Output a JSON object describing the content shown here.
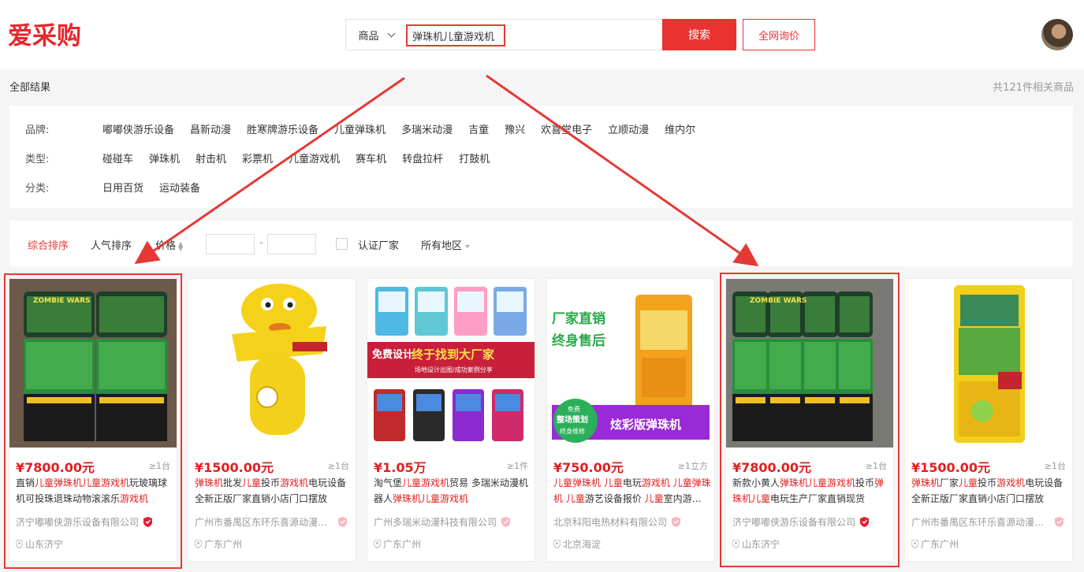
{
  "header": {
    "logo_text": "爱采购",
    "scope_label": "商品",
    "query": "弹珠机儿童游戏机",
    "search_label": "搜索",
    "inquiry_label": "全网询价"
  },
  "results": {
    "all_label": "全部结果",
    "count_text": "共121件相关商品"
  },
  "filters": {
    "brand": {
      "label": "品牌:",
      "items": [
        "嘟嘟侠游乐设备",
        "昌新动漫",
        "胜寒牌游乐设备",
        "儿童弹珠机",
        "多瑞米动漫",
        "吉童",
        "豫兴",
        "欢喜堂电子",
        "立顺动漫",
        "维内尔"
      ]
    },
    "type": {
      "label": "类型:",
      "items": [
        "碰碰车",
        "弹珠机",
        "射击机",
        "彩票机",
        "儿童游戏机",
        "赛车机",
        "转盘拉杆",
        "打鼓机"
      ]
    },
    "category": {
      "label": "分类:",
      "items": [
        "日用百货",
        "运动装备"
      ]
    }
  },
  "sort": {
    "overall": "综合排序",
    "popularity": "人气排序",
    "price": "价格",
    "price_sep": "-",
    "certified": "认证厂家",
    "region": "所有地区"
  },
  "products": [
    {
      "price": "¥7800.00元",
      "moq": "≥1台",
      "title_parts": [
        [
          "直销",
          false
        ],
        [
          "儿童弹珠机儿童游戏机",
          true
        ],
        [
          "玩玻璃球机可投珠退珠动物滚滚乐",
          false
        ],
        [
          "游戏机",
          true
        ]
      ],
      "company": "济宁嘟嘟侠游乐设备有限公司",
      "location": "山东济宁",
      "verified": "bold"
    },
    {
      "price": "¥1500.00元",
      "moq": "≥1台",
      "title_parts": [
        [
          "弹珠机",
          true
        ],
        [
          "批发",
          false
        ],
        [
          "儿童",
          true
        ],
        [
          "投币",
          false
        ],
        [
          "游戏机",
          true
        ],
        [
          "电玩设备全新正版厂家直销小店门口摆放",
          false
        ]
      ],
      "company": "广州市番禺区东环乐喜源动漫产…",
      "location": "广东广州",
      "verified": "light"
    },
    {
      "price": "¥1.05万",
      "moq": "≥1件",
      "title_parts": [
        [
          "淘气堡",
          false
        ],
        [
          "儿童游戏机",
          true
        ],
        [
          "贸易 多瑞米动漫机器人",
          false
        ],
        [
          "弹珠机儿童游戏机",
          true
        ]
      ],
      "company": "广州多瑞米动漫科技有限公司",
      "location": "广东广州",
      "verified": "light"
    },
    {
      "price": "¥750.00元",
      "moq": "≥1立方",
      "title_parts": [
        [
          "儿童弹珠机 儿童",
          true
        ],
        [
          "电玩",
          false
        ],
        [
          "游戏机 儿童弹珠机 儿童",
          true
        ],
        [
          "游艺设备报价 ",
          false
        ],
        [
          "儿童",
          true
        ],
        [
          "室内游…",
          false
        ]
      ],
      "company": "北京科阳电热材料有限公司",
      "location": "北京海淀",
      "verified": "light"
    },
    {
      "price": "¥7800.00元",
      "moq": "≥1台",
      "title_parts": [
        [
          "新款小黄人",
          false
        ],
        [
          "弹珠机儿童游戏机",
          true
        ],
        [
          "投币",
          false
        ],
        [
          "弹珠机儿童",
          true
        ],
        [
          "电玩生产厂家直销现货",
          false
        ]
      ],
      "company": "济宁嘟嘟侠游乐设备有限公司",
      "location": "山东济宁",
      "verified": "bold"
    },
    {
      "price": "¥1500.00元",
      "moq": "≥1台",
      "title_parts": [
        [
          "弹珠机",
          true
        ],
        [
          "厂家",
          false
        ],
        [
          "儿童",
          true
        ],
        [
          "投币",
          false
        ],
        [
          "游戏机",
          true
        ],
        [
          "电玩设备全新正版厂家直销小店门口摆放",
          false
        ]
      ],
      "company": "广州市番禺区东环乐喜源动漫产…",
      "location": "广东广州",
      "verified": "light"
    }
  ],
  "image_text": {
    "p1_brand": "ZOMBIE WARS",
    "p3_banner_left": "免费设计",
    "p3_banner_title": "终于找到大厂家",
    "p3_banner_sub": "场地设计出图/成功案例分享",
    "p4_line1": "厂家直销",
    "p4_line2": "终身售后",
    "p4_badge_top": "免费",
    "p4_badge_mid": "整场策划",
    "p4_badge_bottom": "终身维修",
    "p4_footer": "炫彩版弹珠机"
  },
  "colors": {
    "brand_red": "#ea3232",
    "highlight_red": "#e02020"
  }
}
